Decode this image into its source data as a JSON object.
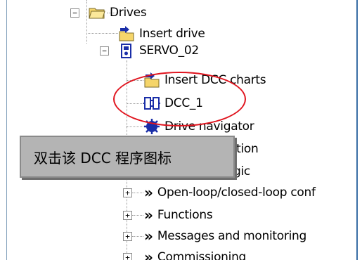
{
  "tree": {
    "drives": {
      "label": "Drives",
      "expander": "−",
      "icon": "folder-open-icon"
    },
    "insert_drive": {
      "label": "Insert drive",
      "icon": "insert-folder-icon"
    },
    "servo": {
      "label": "SERVO_02",
      "expander": "−",
      "icon": "drive-unit-icon"
    },
    "insert_dcc": {
      "label": "Insert DCC charts",
      "icon": "insert-folder-icon"
    },
    "dcc1": {
      "label": "DCC_1",
      "icon": "dcc-chart-icon"
    },
    "navigator": {
      "label": "Drive navigator",
      "icon": "drive-navigator-icon"
    },
    "config": {
      "label": "ation"
    },
    "logic": {
      "label": "gic"
    },
    "open_loop": {
      "label": "Open-loop/closed-loop conf",
      "expander": "+",
      "icon": "double-chevron-icon"
    },
    "functions": {
      "label": "Functions",
      "expander": "+",
      "icon": "double-chevron-icon"
    },
    "messages": {
      "label": "Messages and monitoring",
      "expander": "+",
      "icon": "double-chevron-icon"
    },
    "commissioning": {
      "label": "Commissioning",
      "expander": "+",
      "icon": "double-chevron-icon"
    }
  },
  "callout": {
    "text": "双击该 DCC 程序图标"
  },
  "colors": {
    "highlight_ellipse": "#e0141e",
    "callout_bg": "#b4b4b4",
    "frame_border": "#3a6ea5"
  }
}
